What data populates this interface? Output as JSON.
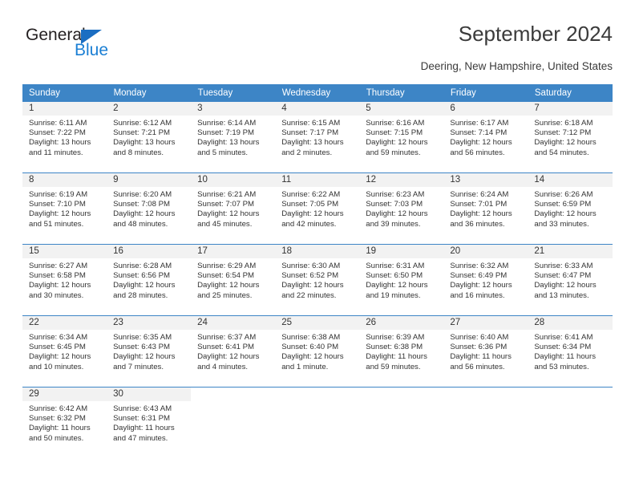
{
  "brand": {
    "name_top": "General",
    "name_bottom": "Blue",
    "triangle_icon": "blue-triangle-icon",
    "accent_color": "#1b7fd4"
  },
  "header": {
    "title": "September 2024",
    "subtitle": "Deering, New Hampshire, United States"
  },
  "theme": {
    "header_bg": "#3d85c6",
    "header_text": "#ffffff",
    "daynum_band_bg": "#f2f2f2",
    "body_text": "#333333",
    "row_rule": "#3d85c6"
  },
  "calendar": {
    "weekday_headers": [
      "Sunday",
      "Monday",
      "Tuesday",
      "Wednesday",
      "Thursday",
      "Friday",
      "Saturday"
    ],
    "weeks": [
      [
        {
          "day": "1",
          "lines": [
            "Sunrise: 6:11 AM",
            "Sunset: 7:22 PM",
            "Daylight: 13 hours",
            "and 11 minutes."
          ]
        },
        {
          "day": "2",
          "lines": [
            "Sunrise: 6:12 AM",
            "Sunset: 7:21 PM",
            "Daylight: 13 hours",
            "and 8 minutes."
          ]
        },
        {
          "day": "3",
          "lines": [
            "Sunrise: 6:14 AM",
            "Sunset: 7:19 PM",
            "Daylight: 13 hours",
            "and 5 minutes."
          ]
        },
        {
          "day": "4",
          "lines": [
            "Sunrise: 6:15 AM",
            "Sunset: 7:17 PM",
            "Daylight: 13 hours",
            "and 2 minutes."
          ]
        },
        {
          "day": "5",
          "lines": [
            "Sunrise: 6:16 AM",
            "Sunset: 7:15 PM",
            "Daylight: 12 hours",
            "and 59 minutes."
          ]
        },
        {
          "day": "6",
          "lines": [
            "Sunrise: 6:17 AM",
            "Sunset: 7:14 PM",
            "Daylight: 12 hours",
            "and 56 minutes."
          ]
        },
        {
          "day": "7",
          "lines": [
            "Sunrise: 6:18 AM",
            "Sunset: 7:12 PM",
            "Daylight: 12 hours",
            "and 54 minutes."
          ]
        }
      ],
      [
        {
          "day": "8",
          "lines": [
            "Sunrise: 6:19 AM",
            "Sunset: 7:10 PM",
            "Daylight: 12 hours",
            "and 51 minutes."
          ]
        },
        {
          "day": "9",
          "lines": [
            "Sunrise: 6:20 AM",
            "Sunset: 7:08 PM",
            "Daylight: 12 hours",
            "and 48 minutes."
          ]
        },
        {
          "day": "10",
          "lines": [
            "Sunrise: 6:21 AM",
            "Sunset: 7:07 PM",
            "Daylight: 12 hours",
            "and 45 minutes."
          ]
        },
        {
          "day": "11",
          "lines": [
            "Sunrise: 6:22 AM",
            "Sunset: 7:05 PM",
            "Daylight: 12 hours",
            "and 42 minutes."
          ]
        },
        {
          "day": "12",
          "lines": [
            "Sunrise: 6:23 AM",
            "Sunset: 7:03 PM",
            "Daylight: 12 hours",
            "and 39 minutes."
          ]
        },
        {
          "day": "13",
          "lines": [
            "Sunrise: 6:24 AM",
            "Sunset: 7:01 PM",
            "Daylight: 12 hours",
            "and 36 minutes."
          ]
        },
        {
          "day": "14",
          "lines": [
            "Sunrise: 6:26 AM",
            "Sunset: 6:59 PM",
            "Daylight: 12 hours",
            "and 33 minutes."
          ]
        }
      ],
      [
        {
          "day": "15",
          "lines": [
            "Sunrise: 6:27 AM",
            "Sunset: 6:58 PM",
            "Daylight: 12 hours",
            "and 30 minutes."
          ]
        },
        {
          "day": "16",
          "lines": [
            "Sunrise: 6:28 AM",
            "Sunset: 6:56 PM",
            "Daylight: 12 hours",
            "and 28 minutes."
          ]
        },
        {
          "day": "17",
          "lines": [
            "Sunrise: 6:29 AM",
            "Sunset: 6:54 PM",
            "Daylight: 12 hours",
            "and 25 minutes."
          ]
        },
        {
          "day": "18",
          "lines": [
            "Sunrise: 6:30 AM",
            "Sunset: 6:52 PM",
            "Daylight: 12 hours",
            "and 22 minutes."
          ]
        },
        {
          "day": "19",
          "lines": [
            "Sunrise: 6:31 AM",
            "Sunset: 6:50 PM",
            "Daylight: 12 hours",
            "and 19 minutes."
          ]
        },
        {
          "day": "20",
          "lines": [
            "Sunrise: 6:32 AM",
            "Sunset: 6:49 PM",
            "Daylight: 12 hours",
            "and 16 minutes."
          ]
        },
        {
          "day": "21",
          "lines": [
            "Sunrise: 6:33 AM",
            "Sunset: 6:47 PM",
            "Daylight: 12 hours",
            "and 13 minutes."
          ]
        }
      ],
      [
        {
          "day": "22",
          "lines": [
            "Sunrise: 6:34 AM",
            "Sunset: 6:45 PM",
            "Daylight: 12 hours",
            "and 10 minutes."
          ]
        },
        {
          "day": "23",
          "lines": [
            "Sunrise: 6:35 AM",
            "Sunset: 6:43 PM",
            "Daylight: 12 hours",
            "and 7 minutes."
          ]
        },
        {
          "day": "24",
          "lines": [
            "Sunrise: 6:37 AM",
            "Sunset: 6:41 PM",
            "Daylight: 12 hours",
            "and 4 minutes."
          ]
        },
        {
          "day": "25",
          "lines": [
            "Sunrise: 6:38 AM",
            "Sunset: 6:40 PM",
            "Daylight: 12 hours",
            "and 1 minute."
          ]
        },
        {
          "day": "26",
          "lines": [
            "Sunrise: 6:39 AM",
            "Sunset: 6:38 PM",
            "Daylight: 11 hours",
            "and 59 minutes."
          ]
        },
        {
          "day": "27",
          "lines": [
            "Sunrise: 6:40 AM",
            "Sunset: 6:36 PM",
            "Daylight: 11 hours",
            "and 56 minutes."
          ]
        },
        {
          "day": "28",
          "lines": [
            "Sunrise: 6:41 AM",
            "Sunset: 6:34 PM",
            "Daylight: 11 hours",
            "and 53 minutes."
          ]
        }
      ],
      [
        {
          "day": "29",
          "lines": [
            "Sunrise: 6:42 AM",
            "Sunset: 6:32 PM",
            "Daylight: 11 hours",
            "and 50 minutes."
          ]
        },
        {
          "day": "30",
          "lines": [
            "Sunrise: 6:43 AM",
            "Sunset: 6:31 PM",
            "Daylight: 11 hours",
            "and 47 minutes."
          ]
        },
        {
          "day": "",
          "lines": []
        },
        {
          "day": "",
          "lines": []
        },
        {
          "day": "",
          "lines": []
        },
        {
          "day": "",
          "lines": []
        },
        {
          "day": "",
          "lines": []
        }
      ]
    ]
  }
}
